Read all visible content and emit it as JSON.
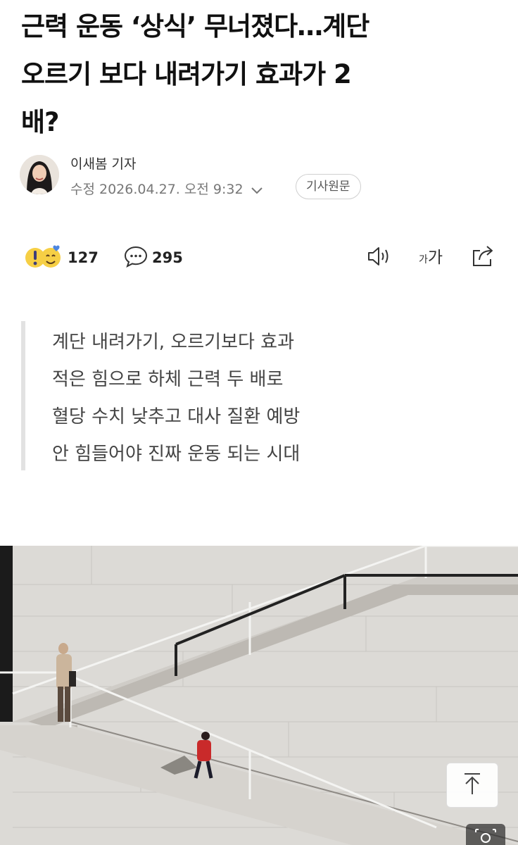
{
  "article": {
    "headline_lines": [
      "근력 운동 ‘상식’ 무너졌다…계단",
      "오르기 보다 내려가기 효과가 2",
      "배?"
    ],
    "reporter": "이새봄 기자",
    "updated_label": "수정 2026.04.27. 오전 9:32",
    "original_button": "기사원문"
  },
  "actions": {
    "reaction_count": "127",
    "comment_count": "295",
    "font_small": "가",
    "font_big": "가"
  },
  "summary": [
    "계단 내려가기, 오르기보다 효과",
    "적은 힘으로 하체 근력 두 배로",
    "혈당 수치 낮추고 대사 질환 예방",
    "안 힘들어야 진짜 운동 되는 시대"
  ],
  "icons": {
    "reaction": "emoji-reaction-icon",
    "comment": "speech-bubble-icon",
    "speaker": "speaker-icon",
    "share": "share-icon",
    "top": "arrow-up-icon",
    "zoom": "zoom-icon",
    "chevron": "chevron-down-icon"
  }
}
